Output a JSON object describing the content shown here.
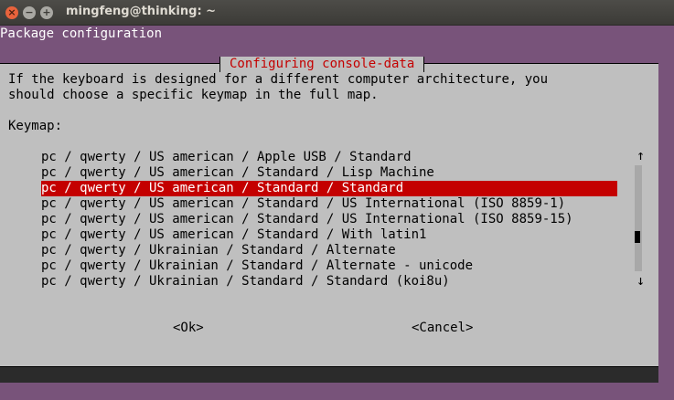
{
  "window": {
    "title": "mingfeng@thinking: ~",
    "close_symbol": "×",
    "minimize_symbol": "−",
    "maximize_symbol": "+"
  },
  "terminal": {
    "header": "Package configuration"
  },
  "dialog": {
    "title": "Configuring console-data",
    "description_line1": "If the keyboard is designed for a different computer architecture, you",
    "description_line2": "should choose a specific keymap in the full map.",
    "keymap_label": "Keymap:",
    "items": [
      "pc / qwerty / US american / Apple USB / Standard",
      "pc / qwerty / US american / Standard / Lisp Machine",
      "pc / qwerty / US american / Standard / Standard",
      "pc / qwerty / US american / Standard / US International (ISO 8859-1)",
      "pc / qwerty / US american / Standard / US International (ISO 8859-15)",
      "pc / qwerty / US american / Standard / With latin1",
      "pc / qwerty / Ukrainian / Standard / Alternate",
      "pc / qwerty / Ukrainian / Standard / Alternate - unicode",
      "pc / qwerty / Ukrainian / Standard / Standard (koi8u)"
    ],
    "selected_index": 2,
    "scroll_up": "↑",
    "scroll_down": "↓",
    "ok_label": "<Ok>",
    "cancel_label": "<Cancel>"
  },
  "colors": {
    "terminal_bg": "#78537a",
    "dialog_bg": "#bfbfbf",
    "selection": "#c40000",
    "title_text": "#c40000"
  }
}
